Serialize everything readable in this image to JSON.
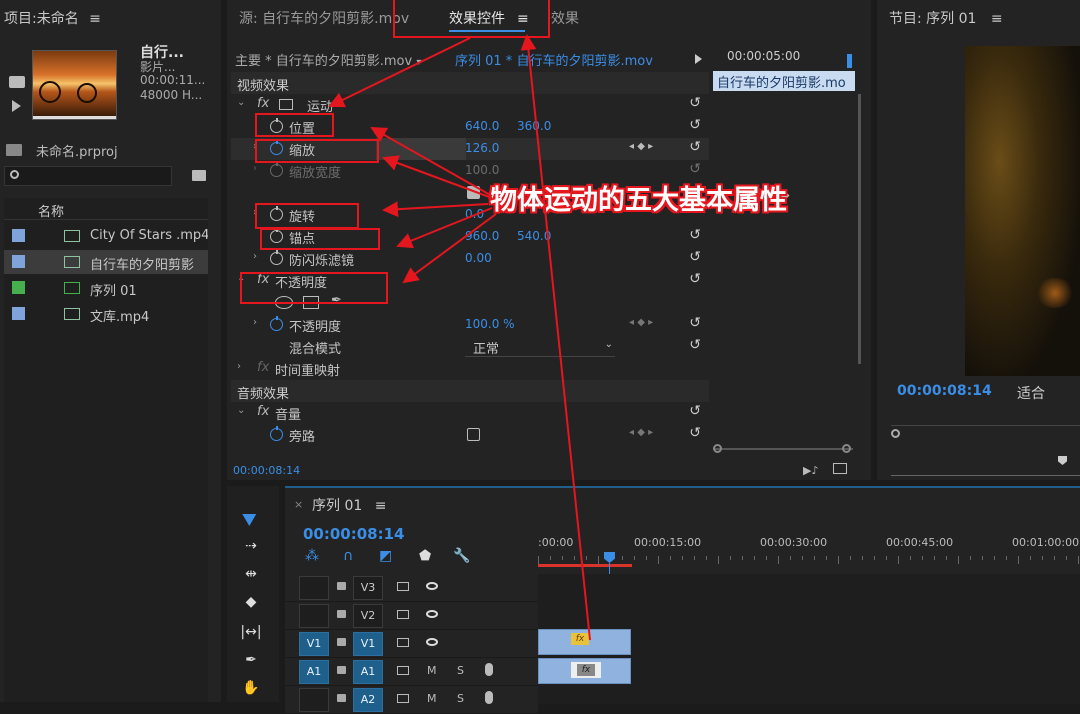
{
  "project": {
    "title": "项目:未命名",
    "menu": "≡",
    "clip_name": "自行...",
    "clip_type": "影片...",
    "clip_dur": "00:00:11...",
    "clip_rate": "48000 H...",
    "file_name": "未命名.prproj",
    "col_header": "名称",
    "items": [
      {
        "name": "City Of Stars .mp4",
        "color": "#7fa4d9"
      },
      {
        "name": "自行车的夕阳剪影",
        "color": "#7fa4d9"
      },
      {
        "name": "序列 01",
        "color": "#46b04f"
      },
      {
        "name": "文库.mp4",
        "color": "#7fa4d9"
      }
    ]
  },
  "source_tab": "源: 自行车的夕阳剪影.mov",
  "effects_tab": "效果控件",
  "effects_tab_menu": "≡",
  "third_tab": "效果",
  "ec": {
    "master": "主要 * 自行车的夕阳剪影.mov",
    "seq_clip": "序列 01 * 自行车的夕阳剪影.mov",
    "time_ruler": "00:00:05:00",
    "clip_bar": "自行车的夕阳剪影.mo",
    "video_effects": "视频效果",
    "fx": "fx",
    "motion": "运动",
    "position": "位置",
    "pos_x": "640.0",
    "pos_y": "360.0",
    "scale": "缩放",
    "scale_val": "126.0",
    "scale_width": "缩放宽度",
    "scale_width_val": "100.0",
    "rotation": "旋转",
    "rotation_val": "0.0",
    "anchor": "锚点",
    "anchor_x": "960.0",
    "anchor_y": "540.0",
    "flicker": "防闪烁滤镜",
    "flicker_val": "0.00",
    "opacity_group": "不透明度",
    "opacity": "不透明度",
    "opacity_val": "100.0 %",
    "blend": "混合模式",
    "blend_val": "正常",
    "time_remap": "时间重映射",
    "audio_effects": "音频效果",
    "volume": "音量",
    "bypass": "旁路",
    "current_time": "00:00:08:14"
  },
  "program": {
    "title": "节目: 序列 01",
    "menu": "≡",
    "timecode": "00:00:08:14",
    "fit": "适合"
  },
  "annotation": "物体运动的五大基本属性",
  "timeline": {
    "tab": "序列 01",
    "menu": "≡",
    "close": "×",
    "timecode": "00:00:08:14",
    "ruler": [
      ":00:00",
      "00:00:15:00",
      "00:00:30:00",
      "00:00:45:00",
      "00:01:00:00"
    ],
    "tracks": [
      {
        "src": "",
        "id": "V3"
      },
      {
        "src": "",
        "id": "V2"
      },
      {
        "src": "V1",
        "id": "V1"
      },
      {
        "src": "A1",
        "id": "A1"
      },
      {
        "src": "",
        "id": "A2"
      }
    ],
    "mute": "M",
    "solo": "S",
    "fx_badge": "fx"
  }
}
